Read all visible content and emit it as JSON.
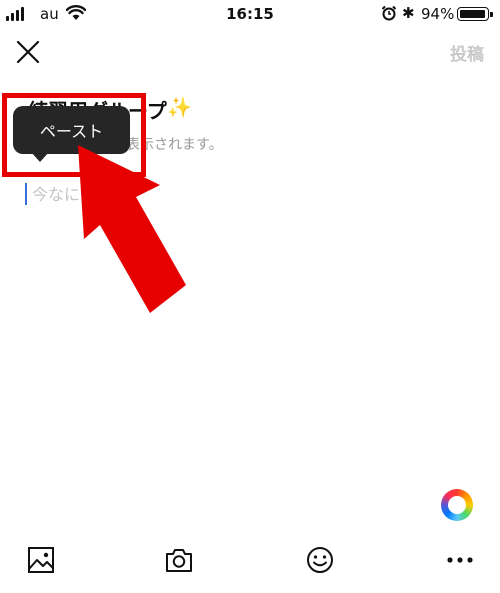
{
  "status_bar": {
    "carrier": "au",
    "time": "16:15",
    "battery": "94%"
  },
  "header": {
    "post_label": "投稿"
  },
  "group": {
    "name": "練習用グループ",
    "notice": "メンバー全員に表示されます。"
  },
  "composer": {
    "placeholder": "今なにしてる？"
  },
  "context_menu": {
    "paste_label": "ペースト"
  },
  "toolbar": {
    "icons": [
      "image-icon",
      "camera-icon",
      "smiley-icon",
      "more-icon"
    ]
  },
  "colors": {
    "annotation_red": "#e60000",
    "caret_blue": "#3a6fd8",
    "post_disabled": "#c8c8c8"
  }
}
